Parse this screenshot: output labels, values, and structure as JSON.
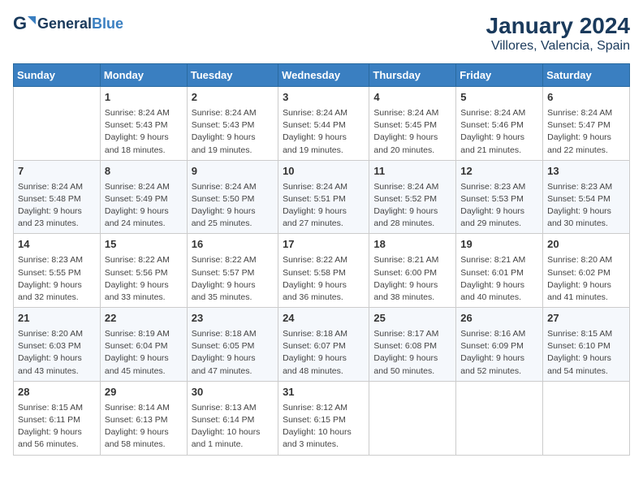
{
  "header": {
    "logo_line1": "General",
    "logo_line2": "Blue",
    "title": "January 2024",
    "subtitle": "Villores, Valencia, Spain"
  },
  "days_of_week": [
    "Sunday",
    "Monday",
    "Tuesday",
    "Wednesday",
    "Thursday",
    "Friday",
    "Saturday"
  ],
  "weeks": [
    [
      {
        "day": "",
        "content": ""
      },
      {
        "day": "1",
        "content": "Sunrise: 8:24 AM\nSunset: 5:43 PM\nDaylight: 9 hours\nand 18 minutes."
      },
      {
        "day": "2",
        "content": "Sunrise: 8:24 AM\nSunset: 5:43 PM\nDaylight: 9 hours\nand 19 minutes."
      },
      {
        "day": "3",
        "content": "Sunrise: 8:24 AM\nSunset: 5:44 PM\nDaylight: 9 hours\nand 19 minutes."
      },
      {
        "day": "4",
        "content": "Sunrise: 8:24 AM\nSunset: 5:45 PM\nDaylight: 9 hours\nand 20 minutes."
      },
      {
        "day": "5",
        "content": "Sunrise: 8:24 AM\nSunset: 5:46 PM\nDaylight: 9 hours\nand 21 minutes."
      },
      {
        "day": "6",
        "content": "Sunrise: 8:24 AM\nSunset: 5:47 PM\nDaylight: 9 hours\nand 22 minutes."
      }
    ],
    [
      {
        "day": "7",
        "content": "Sunrise: 8:24 AM\nSunset: 5:48 PM\nDaylight: 9 hours\nand 23 minutes."
      },
      {
        "day": "8",
        "content": "Sunrise: 8:24 AM\nSunset: 5:49 PM\nDaylight: 9 hours\nand 24 minutes."
      },
      {
        "day": "9",
        "content": "Sunrise: 8:24 AM\nSunset: 5:50 PM\nDaylight: 9 hours\nand 25 minutes."
      },
      {
        "day": "10",
        "content": "Sunrise: 8:24 AM\nSunset: 5:51 PM\nDaylight: 9 hours\nand 27 minutes."
      },
      {
        "day": "11",
        "content": "Sunrise: 8:24 AM\nSunset: 5:52 PM\nDaylight: 9 hours\nand 28 minutes."
      },
      {
        "day": "12",
        "content": "Sunrise: 8:23 AM\nSunset: 5:53 PM\nDaylight: 9 hours\nand 29 minutes."
      },
      {
        "day": "13",
        "content": "Sunrise: 8:23 AM\nSunset: 5:54 PM\nDaylight: 9 hours\nand 30 minutes."
      }
    ],
    [
      {
        "day": "14",
        "content": "Sunrise: 8:23 AM\nSunset: 5:55 PM\nDaylight: 9 hours\nand 32 minutes."
      },
      {
        "day": "15",
        "content": "Sunrise: 8:22 AM\nSunset: 5:56 PM\nDaylight: 9 hours\nand 33 minutes."
      },
      {
        "day": "16",
        "content": "Sunrise: 8:22 AM\nSunset: 5:57 PM\nDaylight: 9 hours\nand 35 minutes."
      },
      {
        "day": "17",
        "content": "Sunrise: 8:22 AM\nSunset: 5:58 PM\nDaylight: 9 hours\nand 36 minutes."
      },
      {
        "day": "18",
        "content": "Sunrise: 8:21 AM\nSunset: 6:00 PM\nDaylight: 9 hours\nand 38 minutes."
      },
      {
        "day": "19",
        "content": "Sunrise: 8:21 AM\nSunset: 6:01 PM\nDaylight: 9 hours\nand 40 minutes."
      },
      {
        "day": "20",
        "content": "Sunrise: 8:20 AM\nSunset: 6:02 PM\nDaylight: 9 hours\nand 41 minutes."
      }
    ],
    [
      {
        "day": "21",
        "content": "Sunrise: 8:20 AM\nSunset: 6:03 PM\nDaylight: 9 hours\nand 43 minutes."
      },
      {
        "day": "22",
        "content": "Sunrise: 8:19 AM\nSunset: 6:04 PM\nDaylight: 9 hours\nand 45 minutes."
      },
      {
        "day": "23",
        "content": "Sunrise: 8:18 AM\nSunset: 6:05 PM\nDaylight: 9 hours\nand 47 minutes."
      },
      {
        "day": "24",
        "content": "Sunrise: 8:18 AM\nSunset: 6:07 PM\nDaylight: 9 hours\nand 48 minutes."
      },
      {
        "day": "25",
        "content": "Sunrise: 8:17 AM\nSunset: 6:08 PM\nDaylight: 9 hours\nand 50 minutes."
      },
      {
        "day": "26",
        "content": "Sunrise: 8:16 AM\nSunset: 6:09 PM\nDaylight: 9 hours\nand 52 minutes."
      },
      {
        "day": "27",
        "content": "Sunrise: 8:15 AM\nSunset: 6:10 PM\nDaylight: 9 hours\nand 54 minutes."
      }
    ],
    [
      {
        "day": "28",
        "content": "Sunrise: 8:15 AM\nSunset: 6:11 PM\nDaylight: 9 hours\nand 56 minutes."
      },
      {
        "day": "29",
        "content": "Sunrise: 8:14 AM\nSunset: 6:13 PM\nDaylight: 9 hours\nand 58 minutes."
      },
      {
        "day": "30",
        "content": "Sunrise: 8:13 AM\nSunset: 6:14 PM\nDaylight: 10 hours\nand 1 minute."
      },
      {
        "day": "31",
        "content": "Sunrise: 8:12 AM\nSunset: 6:15 PM\nDaylight: 10 hours\nand 3 minutes."
      },
      {
        "day": "",
        "content": ""
      },
      {
        "day": "",
        "content": ""
      },
      {
        "day": "",
        "content": ""
      }
    ]
  ]
}
